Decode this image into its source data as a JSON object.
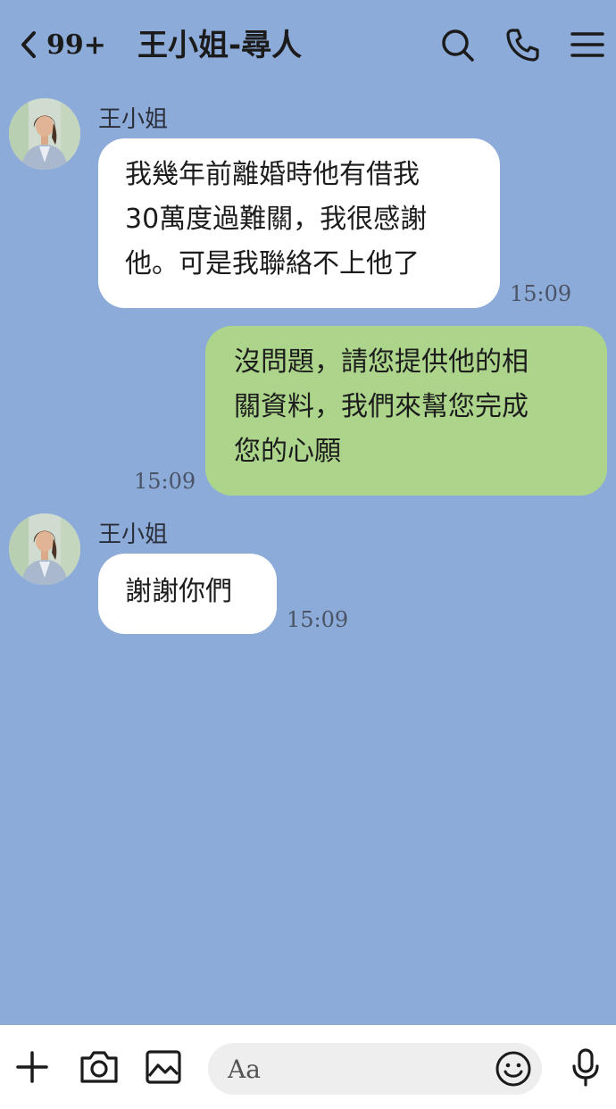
{
  "header": {
    "unread_count": "99+",
    "title": "王小姐-尋人",
    "icons": [
      "chevron-left-icon",
      "search-icon",
      "phone-icon",
      "menu-icon"
    ]
  },
  "messages": [
    {
      "direction": "incoming",
      "sender": "王小姐",
      "lines": [
        "我幾年前離婚時他有借我",
        "30萬度過難關，我很感謝",
        "他。可是我聯絡不上他了"
      ],
      "time": "15:09"
    },
    {
      "direction": "outgoing",
      "lines": [
        "沒問題，請您提供他的相",
        "關資料，我們來幫您完成",
        "您的心願"
      ],
      "time": "15:09"
    },
    {
      "direction": "incoming",
      "sender": "王小姐",
      "lines": [
        "謝謝你們"
      ],
      "time": "15:09"
    }
  ],
  "composer": {
    "placeholder": "Aa",
    "icons": [
      "plus-icon",
      "camera-icon",
      "image-icon",
      "emoji-icon",
      "microphone-icon"
    ]
  },
  "colors": {
    "background": "#8cabd9",
    "incoming_bubble": "#ffffff",
    "outgoing_bubble": "#acd58b",
    "composer_bar": "#ffffff",
    "input_field": "#eeeeee"
  }
}
